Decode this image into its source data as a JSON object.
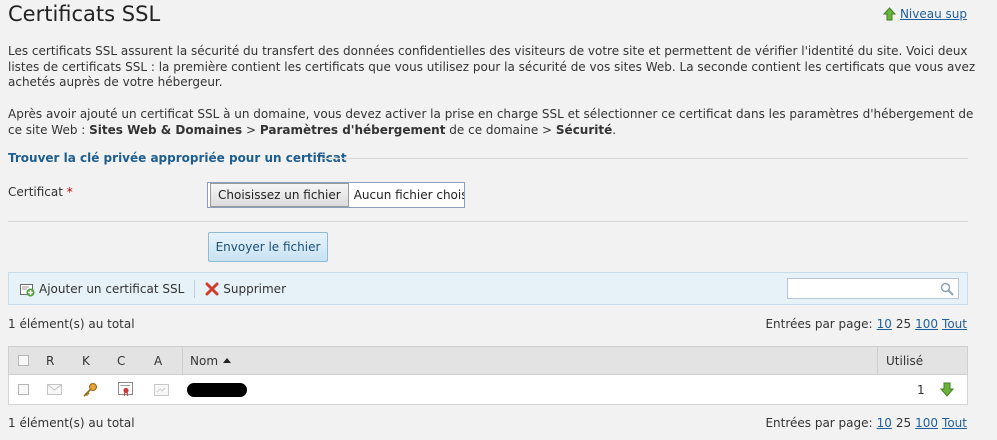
{
  "page": {
    "title": "Certificats SSL",
    "up_link": "Niveau sup"
  },
  "intro": {
    "p1": "Les certificats SSL assurent la sécurité du transfert des données confidentielles des visiteurs de votre site et permettent de vérifier l'identité du site. Voici deux listes de certificats SSL : la première contient les certificats que vous utilisez pour la sécurité de vos sites Web. La seconde contient les certificats que vous avez achetés auprès de votre hébergeur.",
    "p2_a": "Après avoir ajouté un certificat SSL à un domaine, vous devez activer la prise en charge SSL et sélectionner ce certificat dans les paramètres d'hébergement de ce site Web : ",
    "p2_b": "Sites Web & Domaines",
    "p2_c": " > ",
    "p2_d": "Paramètres d'hébergement",
    "p2_e": " de ce domaine > ",
    "p2_f": "Sécurité",
    "p2_g": "."
  },
  "form": {
    "section_title": "Trouver la clé privée appropriée pour un certificat",
    "certificate_label": "Certificat",
    "required_mark": "*",
    "choose_file": "Choisissez un fichier",
    "no_file": "Aucun fichier choisi",
    "send_button": "Envoyer le fichier"
  },
  "toolbar": {
    "add_label": "Ajouter un certificat SSL",
    "delete_label": "Supprimer",
    "search_placeholder": ""
  },
  "list": {
    "total_text": "1 élément(s) au total",
    "per_page_label": "Entrées par page:",
    "per_page_options": [
      "10",
      "25",
      "100",
      "Tout"
    ],
    "columns": {
      "r": "R",
      "k": "K",
      "c": "C",
      "a": "A",
      "name": "Nom",
      "used": "Utilisé"
    },
    "rows": [
      {
        "name": "",
        "used": "1"
      }
    ]
  },
  "colors": {
    "accent": "#1d5e8e",
    "link": "#1f5f9f",
    "toolbar_bg": "#e6f1f8",
    "page_bg": "#f2f2f2"
  },
  "icons": {
    "up": "arrow-up-icon",
    "add": "add-certificate-icon",
    "delete": "delete-x-icon",
    "search": "search-icon",
    "r": "envelope-icon",
    "k": "key-icon",
    "c": "certificate-icon",
    "a": "ca-icon",
    "download": "download-arrow-icon"
  }
}
